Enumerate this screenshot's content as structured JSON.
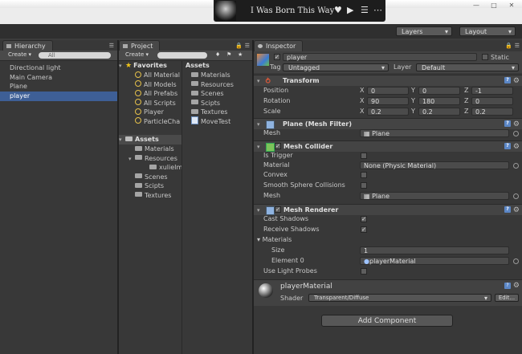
{
  "music": {
    "title": "I Was Born This Way",
    "icons": [
      "heart-icon",
      "play-icon",
      "list-icon",
      "more-icon"
    ]
  },
  "window_controls": [
    "minimize-icon",
    "maximize-icon",
    "close-icon"
  ],
  "toolbar": {
    "layers": "Layers",
    "layout": "Layout"
  },
  "hierarchy": {
    "tab": "Hierarchy",
    "create": "Create",
    "search_placeholder": "All",
    "items": [
      "Directional light",
      "Main Camera",
      "Plane",
      "player"
    ],
    "selected_index": 3
  },
  "project": {
    "tab": "Project",
    "create": "Create",
    "favorites": {
      "label": "Favorites",
      "items": [
        "All Material",
        "All Models",
        "All Prefabs",
        "All Scripts",
        "Player",
        "ParticleCha"
      ]
    },
    "assets": {
      "label": "Assets",
      "items": [
        "Materials",
        "Resources",
        "xulieIma",
        "Scenes",
        "Scipts",
        "Textures"
      ]
    },
    "assets_list": {
      "label": "Assets",
      "items": [
        "Materials",
        "Resources",
        "Scenes",
        "Scipts",
        "Textures",
        "MoveTest"
      ]
    }
  },
  "inspector": {
    "tab": "Inspector",
    "object_name": "player",
    "static_label": "Static",
    "tag_label": "Tag",
    "tag_value": "Untagged",
    "layer_label": "Layer",
    "layer_value": "Default",
    "transform": {
      "title": "Transform",
      "position": {
        "label": "Position",
        "x": "0",
        "y": "0",
        "z": "-1"
      },
      "rotation": {
        "label": "Rotation",
        "x": "90",
        "y": "180",
        "z": "0"
      },
      "scale": {
        "label": "Scale",
        "x": "0.2",
        "y": "0.2",
        "z": "0.2"
      }
    },
    "mesh_filter": {
      "title": "Plane (Mesh Filter)",
      "mesh_label": "Mesh",
      "mesh_value": "Plane"
    },
    "mesh_collider": {
      "title": "Mesh Collider",
      "is_trigger": "Is Trigger",
      "material_label": "Material",
      "material_value": "None (Physic Material)",
      "convex": "Convex",
      "smooth": "Smooth Sphere Collisions",
      "mesh_label": "Mesh",
      "mesh_value": "Plane"
    },
    "mesh_renderer": {
      "title": "Mesh Renderer",
      "cast_shadows": "Cast Shadows",
      "receive_shadows": "Receive Shadows",
      "materials": "Materials",
      "size_label": "Size",
      "size_value": "1",
      "element_label": "Element 0",
      "element_value": "playerMaterial",
      "light_probes": "Use Light Probes"
    },
    "material": {
      "name": "playerMaterial",
      "shader_label": "Shader",
      "shader_value": "Transparent/Diffuse",
      "edit": "Edit..."
    },
    "add_component": "Add Component",
    "axis": {
      "x": "X",
      "y": "Y",
      "z": "Z"
    }
  },
  "colors": {
    "selection": "#3e5f96",
    "panel": "#383838",
    "header": "#444444"
  }
}
